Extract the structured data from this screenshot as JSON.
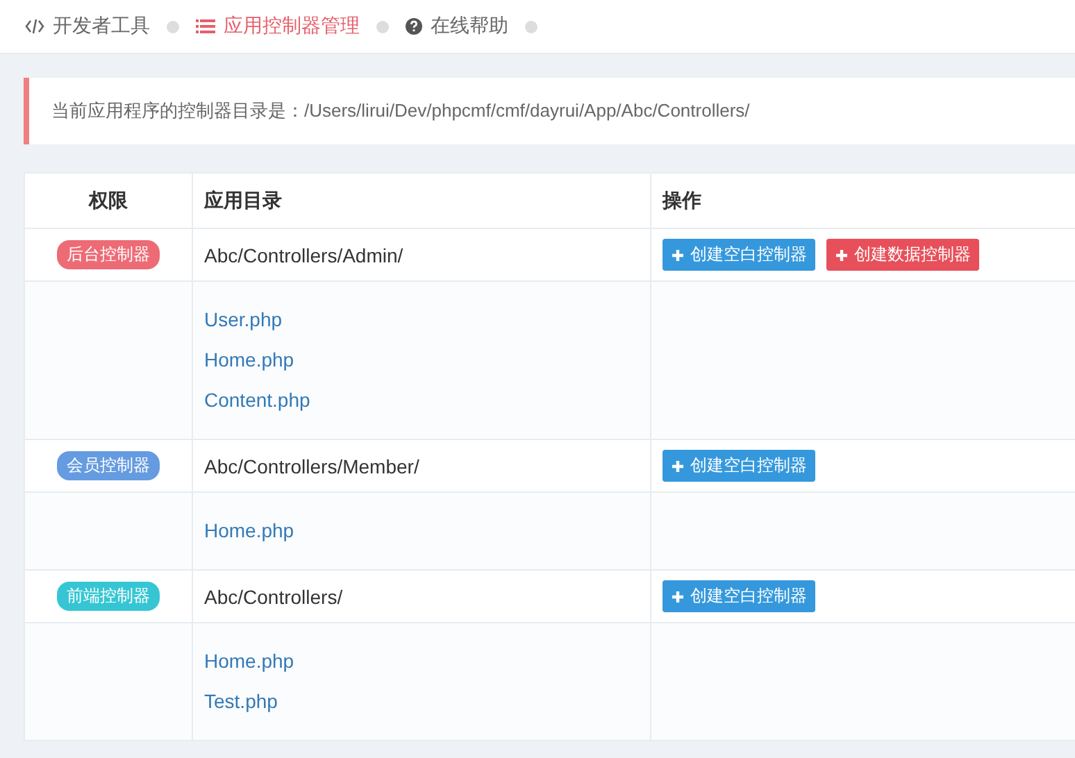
{
  "breadcrumbs": [
    {
      "label": "开发者工具",
      "kind": "code",
      "selected": false
    },
    {
      "label": "应用控制器管理",
      "kind": "list",
      "selected": true
    },
    {
      "label": "在线帮助",
      "kind": "help",
      "selected": false
    }
  ],
  "notice": "当前应用程序的控制器目录是：/Users/lirui/Dev/phpcmf/cmf/dayrui/App/Abc/Controllers/",
  "table": {
    "columns": [
      "权限",
      "应用目录",
      "操作"
    ],
    "groups": [
      {
        "badge": "后台控制器",
        "color": "#ed6b75",
        "directory": "Abc/Controllers/Admin/",
        "actions": [
          {
            "label": "创建空白控制器",
            "kind": "blank"
          },
          {
            "label": "创建数据控制器",
            "kind": "data"
          }
        ],
        "files": [
          "User.php",
          "Home.php",
          "Content.php"
        ]
      },
      {
        "badge": "会员控制器",
        "color": "#659be0",
        "directory": "Abc/Controllers/Member/",
        "actions": [
          {
            "label": "创建空白控制器",
            "kind": "blank"
          }
        ],
        "files": [
          "Home.php"
        ]
      },
      {
        "badge": "前端控制器",
        "color": "#36c6d3",
        "directory": "Abc/Controllers/",
        "actions": [
          {
            "label": "创建空白控制器",
            "kind": "blank"
          }
        ],
        "files": [
          "Home.php",
          "Test.php"
        ]
      }
    ]
  }
}
